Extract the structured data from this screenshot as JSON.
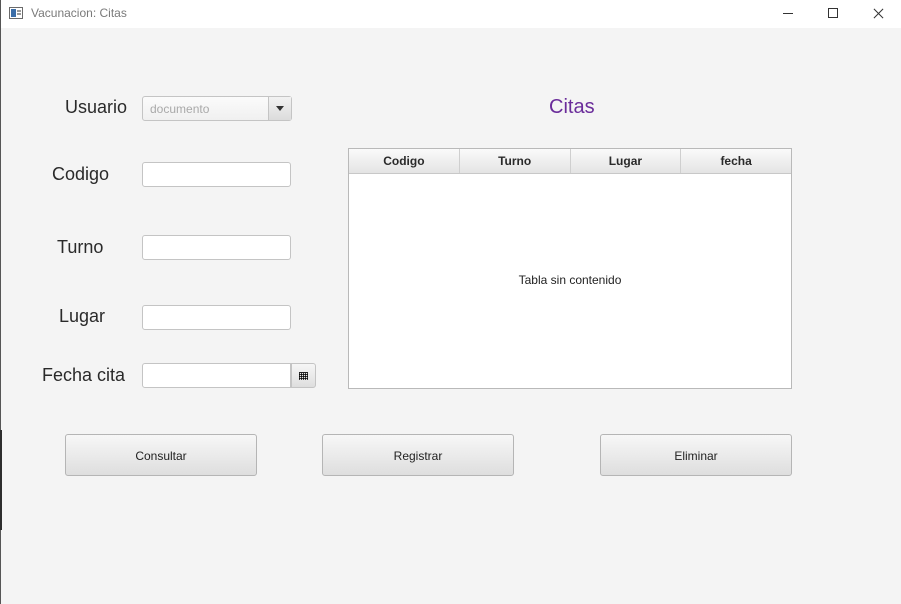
{
  "window": {
    "title": "Vacunacion: Citas",
    "controls": [
      "minimize",
      "maximize",
      "close"
    ]
  },
  "form": {
    "usuario_label": "Usuario",
    "usuario_placeholder": "documento",
    "codigo_label": "Codigo",
    "codigo_value": "",
    "turno_label": "Turno",
    "turno_value": "",
    "lugar_label": "Lugar",
    "lugar_value": "",
    "fecha_label": "Fecha cita",
    "fecha_value": ""
  },
  "table": {
    "title": "Citas",
    "columns": [
      "Codigo",
      "Turno",
      "Lugar",
      "fecha"
    ],
    "rows": [],
    "empty_text": "Tabla sin contenido"
  },
  "buttons": {
    "consultar": "Consultar",
    "registrar": "Registrar",
    "eliminar": "Eliminar"
  },
  "colors": {
    "accent_title": "#6a2c9a",
    "background": "#f4f4f4"
  }
}
